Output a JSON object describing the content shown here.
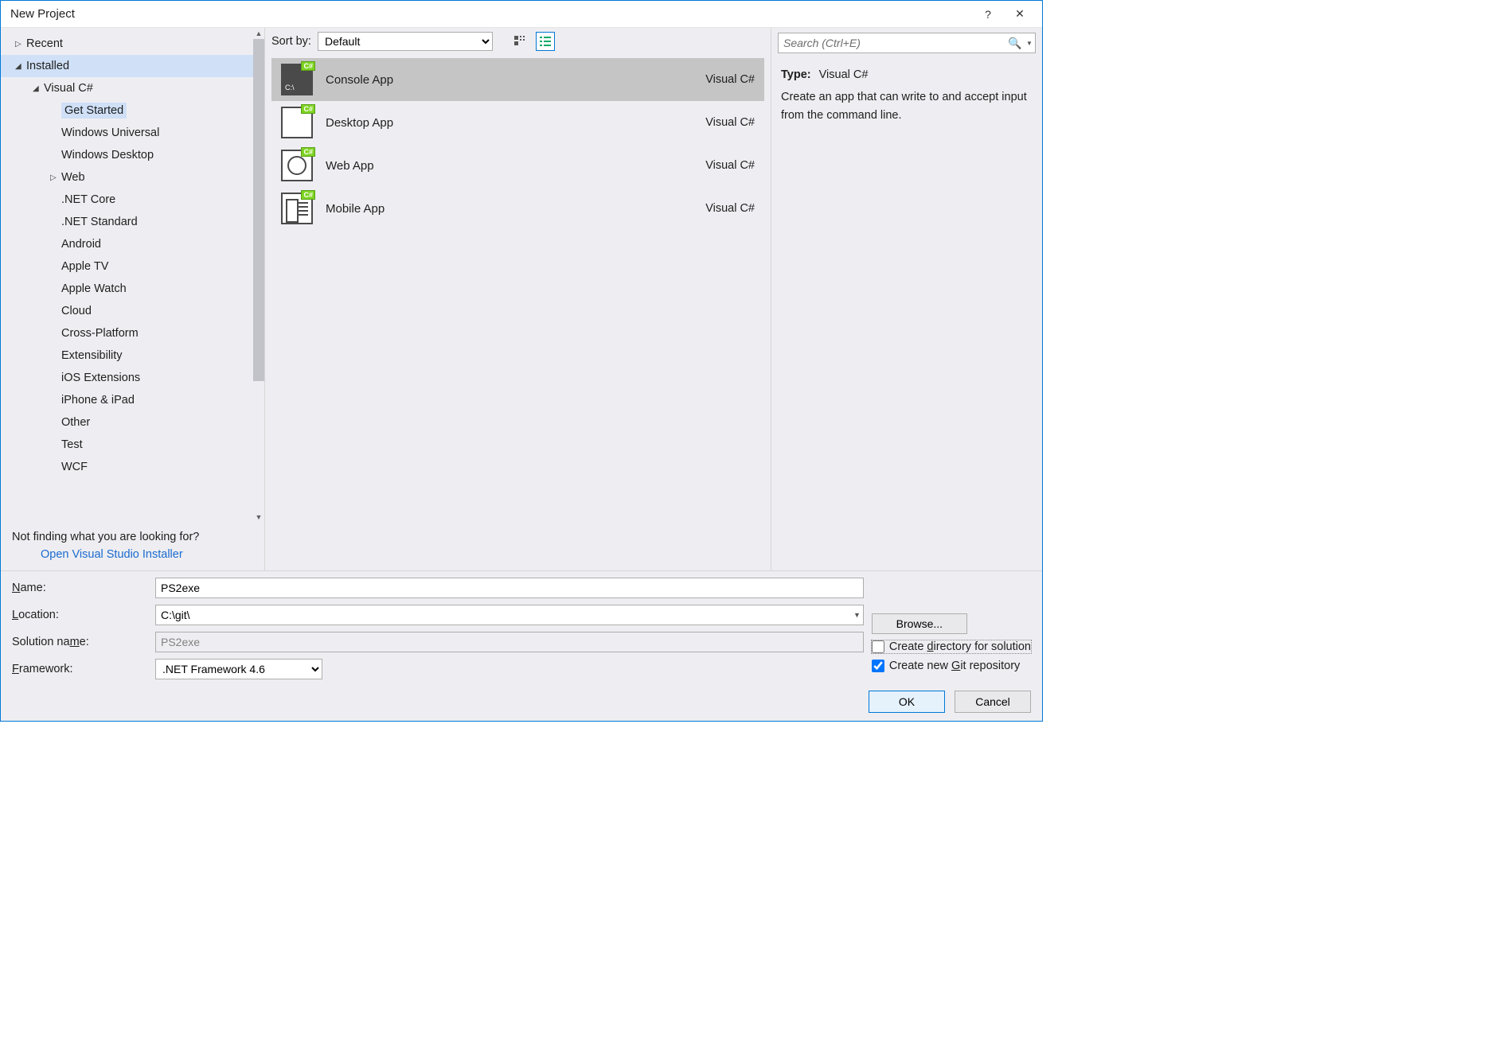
{
  "title": "New Project",
  "titlebar": {
    "help": "?",
    "close": "✕"
  },
  "tree": {
    "recent_label": "Recent",
    "installed_label": "Installed",
    "visual_csharp_label": "Visual C#",
    "children": [
      {
        "label": "Get Started",
        "selected": true
      },
      {
        "label": "Windows Universal"
      },
      {
        "label": "Windows Desktop"
      },
      {
        "label": "Web",
        "expandable": true
      },
      {
        "label": ".NET Core"
      },
      {
        "label": ".NET Standard"
      },
      {
        "label": "Android"
      },
      {
        "label": "Apple TV"
      },
      {
        "label": "Apple Watch"
      },
      {
        "label": "Cloud"
      },
      {
        "label": "Cross-Platform"
      },
      {
        "label": "Extensibility"
      },
      {
        "label": "iOS Extensions"
      },
      {
        "label": "iPhone & iPad"
      },
      {
        "label": "Other"
      },
      {
        "label": "Test"
      },
      {
        "label": "WCF"
      }
    ],
    "footer_hint": "Not finding what you are looking for?",
    "footer_link": "Open Visual Studio Installer"
  },
  "toolbar": {
    "sort_label": "Sort by:",
    "sort_value": "Default"
  },
  "templates": [
    {
      "name": "Console App",
      "lang": "Visual C#",
      "icon": "console",
      "selected": true
    },
    {
      "name": "Desktop App",
      "lang": "Visual C#",
      "icon": "desktop"
    },
    {
      "name": "Web App",
      "lang": "Visual C#",
      "icon": "web"
    },
    {
      "name": "Mobile App",
      "lang": "Visual C#",
      "icon": "mobile"
    }
  ],
  "search": {
    "placeholder": "Search (Ctrl+E)"
  },
  "details": {
    "type_label": "Type:",
    "type_value": "Visual C#",
    "description": "Create an app that can write to and accept input from the command line."
  },
  "form": {
    "name_label_pre": "N",
    "name_label_post": "ame:",
    "name_value": "PS2exe",
    "location_label_pre": "L",
    "location_label_post": "ocation:",
    "location_value": "C:\\git\\",
    "browse_pre": "B",
    "browse_post": "rowse...",
    "solution_label": "Solution name:",
    "solution_ul": "m",
    "solution_value": "PS2exe",
    "framework_label_pre": "F",
    "framework_label_post": "ramework:",
    "framework_value": ".NET Framework 4.6",
    "create_dir_label": "Create directory for solution",
    "create_dir_ul": "d",
    "create_dir_checked": false,
    "create_git_label": "Create new Git repository",
    "create_git_ul": "G",
    "create_git_checked": true,
    "ok": "OK",
    "cancel": "Cancel"
  }
}
